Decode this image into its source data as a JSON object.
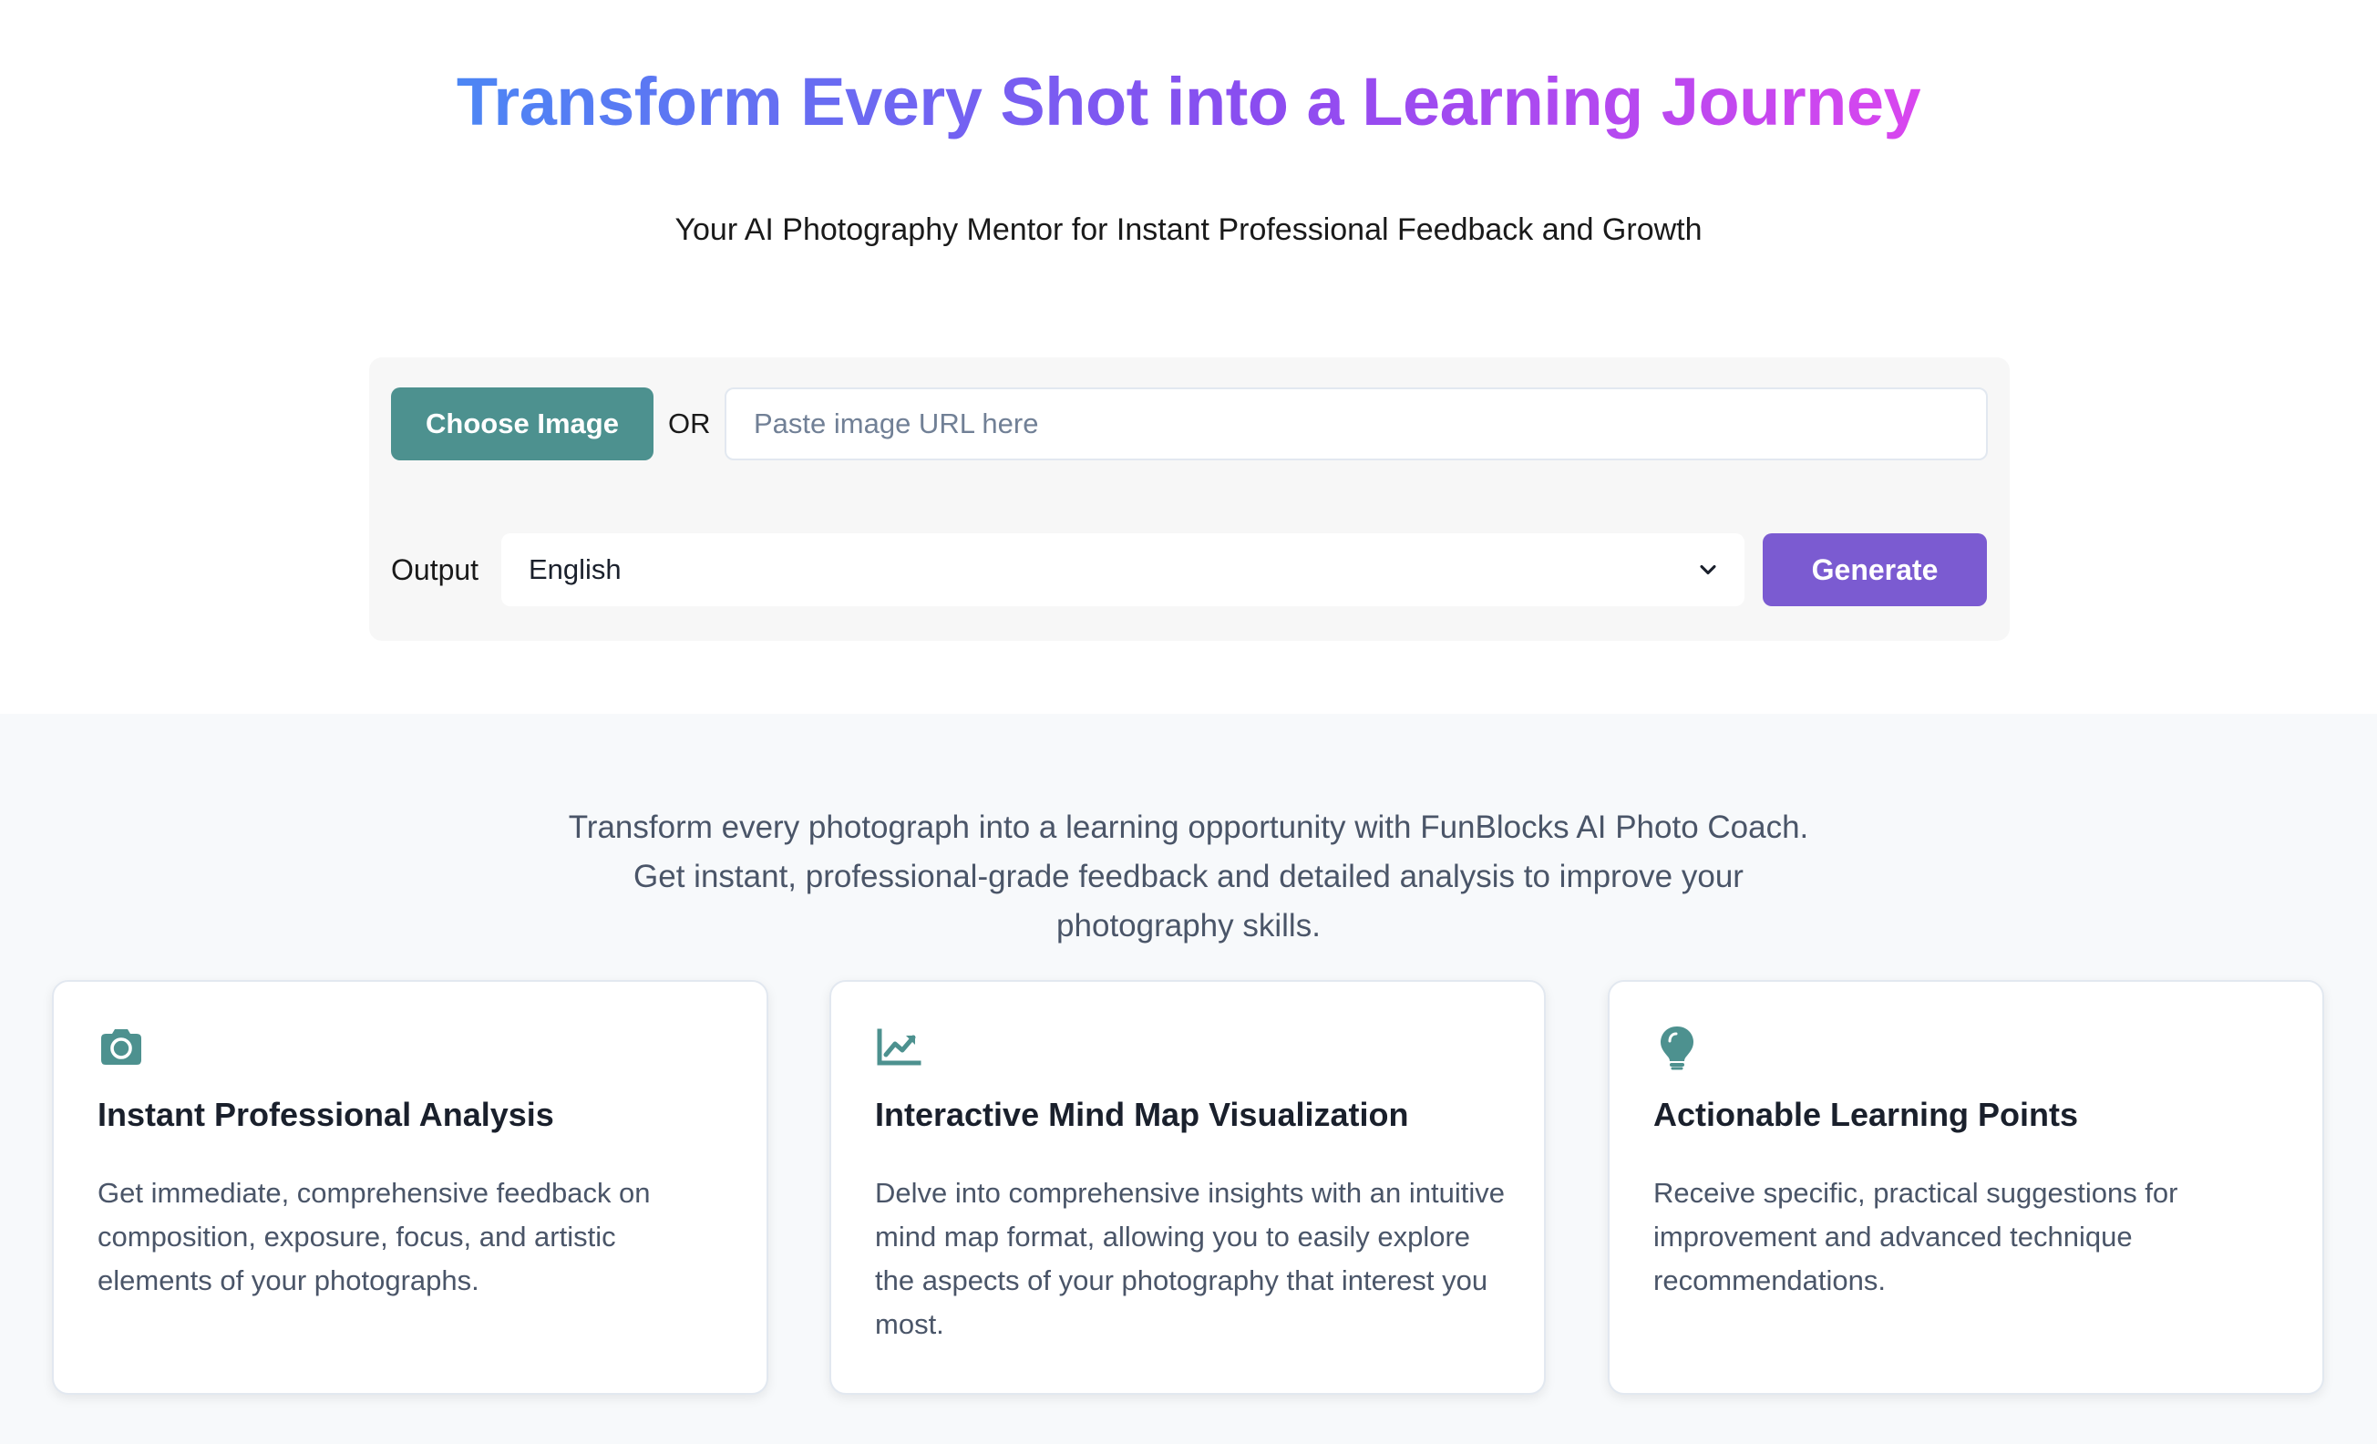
{
  "hero": {
    "title": "Transform Every Shot into a Learning Journey",
    "subtitle": "Your AI Photography Mentor for Instant Professional Feedback and Growth"
  },
  "upload": {
    "choose_label": "Choose Image",
    "or_label": "OR",
    "url_placeholder": "Paste image URL here",
    "url_value": ""
  },
  "output": {
    "label": "Output",
    "selected": "English"
  },
  "generate_label": "Generate",
  "intro": "Transform every photograph into a learning opportunity with FunBlocks AI Photo Coach. Get instant, professional-grade feedback and detailed analysis to improve your photography skills.",
  "features": [
    {
      "icon": "camera-icon",
      "title": "Instant Professional Analysis",
      "text": "Get immediate, comprehensive feedback on composition, exposure, focus, and artistic elements of your photographs."
    },
    {
      "icon": "chart-line-icon",
      "title": "Interactive Mind Map Visualization",
      "text": "Delve into comprehensive insights with an intuitive mind map format, allowing you to easily explore the aspects of your photography that interest you most."
    },
    {
      "icon": "lightbulb-icon",
      "title": "Actionable Learning Points",
      "text": "Receive specific, practical suggestions for improvement and advanced technique recommendations."
    }
  ],
  "colors": {
    "title_gradient": [
      "#4c86f4",
      "#8b4cf0",
      "#d946ef"
    ],
    "choose_button": "#4d918f",
    "generate_button": "#7b5bd1",
    "icon_accent": "#4d918f"
  }
}
